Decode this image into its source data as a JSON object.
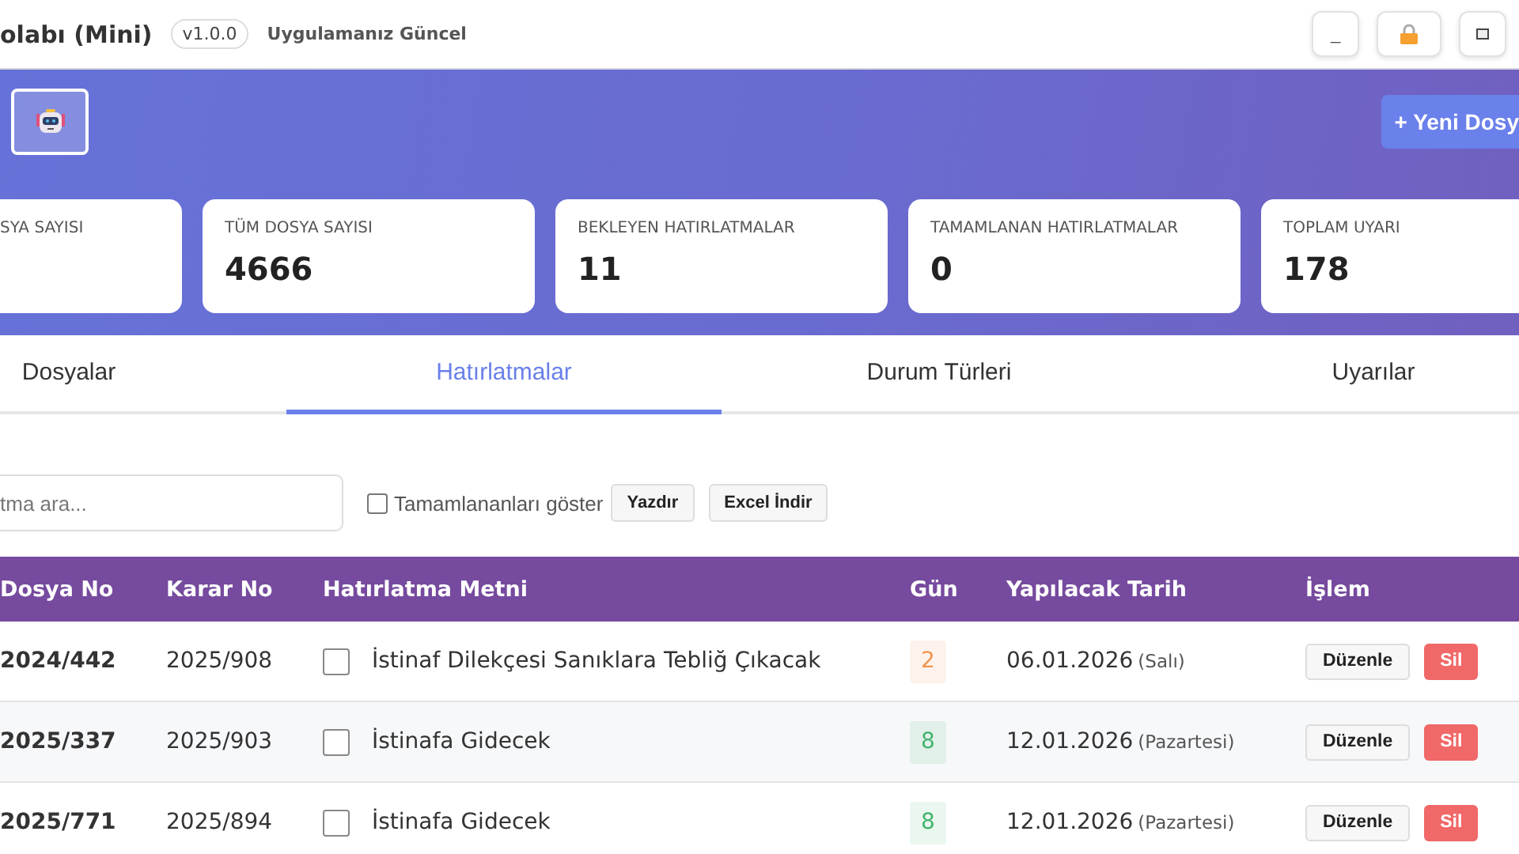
{
  "title_bar": {
    "app_title": "olabı (Mini)",
    "version": "v1.0.0",
    "update_status": "Uygulamanız Güncel",
    "buttons": [
      {
        "kind": "minimize",
        "label": "_"
      },
      {
        "kind": "lock"
      },
      {
        "kind": "maximize"
      }
    ]
  },
  "header": {
    "new_file_button": "+ Yeni Dosy"
  },
  "stats": [
    {
      "label": "SYA SAYISI"
    },
    {
      "label": "TÜM DOSYA SAYISI",
      "value": "4666"
    },
    {
      "label": "BEKLEYEN HATIRLATMALAR",
      "value": "11"
    },
    {
      "label": "TAMAMLANAN HATIRLATMALAR",
      "value": "0"
    },
    {
      "label": "TOPLAM UYARI",
      "value": "178"
    }
  ],
  "tabs": [
    {
      "label": "Dosyalar",
      "selected": false
    },
    {
      "label": "Hatırlatmalar",
      "selected": true
    },
    {
      "label": "Durum Türleri",
      "selected": false
    },
    {
      "label": "Uyarılar",
      "selected": false
    }
  ],
  "toolbar": {
    "search": {
      "placeholder": "tma ara..."
    },
    "show_completed": {
      "label": "Tamamlananları göster",
      "checked": false
    },
    "buttons": [
      "Yazdır",
      "Excel İndir"
    ]
  },
  "table": {
    "columns": [
      "Dosya No",
      "Karar No",
      "Hatırlatma Metni",
      "Gün",
      "Yapılacak Tarih",
      "İşlem"
    ],
    "rows": [
      {
        "dosya_no": "2024/442",
        "karar_no": "2025/908",
        "done": false,
        "text": "İstinaf Dilekçesi Sanıklara Tebliğ Çıkacak",
        "days": "2",
        "color": "#f0954f",
        "date": "06.01.2026",
        "weekday": "(Salı)",
        "actions": [
          "Düzenle",
          "Sil"
        ]
      },
      {
        "dosya_no": "2025/337",
        "karar_no": "2025/903",
        "done": false,
        "text": "İstinafa Gidecek",
        "days": "8",
        "color": "#3fb46b",
        "date": "12.01.2026",
        "weekday": "(Pazartesi)",
        "actions": [
          "Düzenle",
          "Sil"
        ]
      },
      {
        "dosya_no": "2025/771",
        "karar_no": "2025/894",
        "done": false,
        "text": "İstinafa Gidecek",
        "days": "8",
        "color": "#3fb46b",
        "date": "12.01.2026",
        "weekday": "(Pazartesi)",
        "actions": [
          "Düzenle",
          "Sil"
        ]
      }
    ]
  }
}
